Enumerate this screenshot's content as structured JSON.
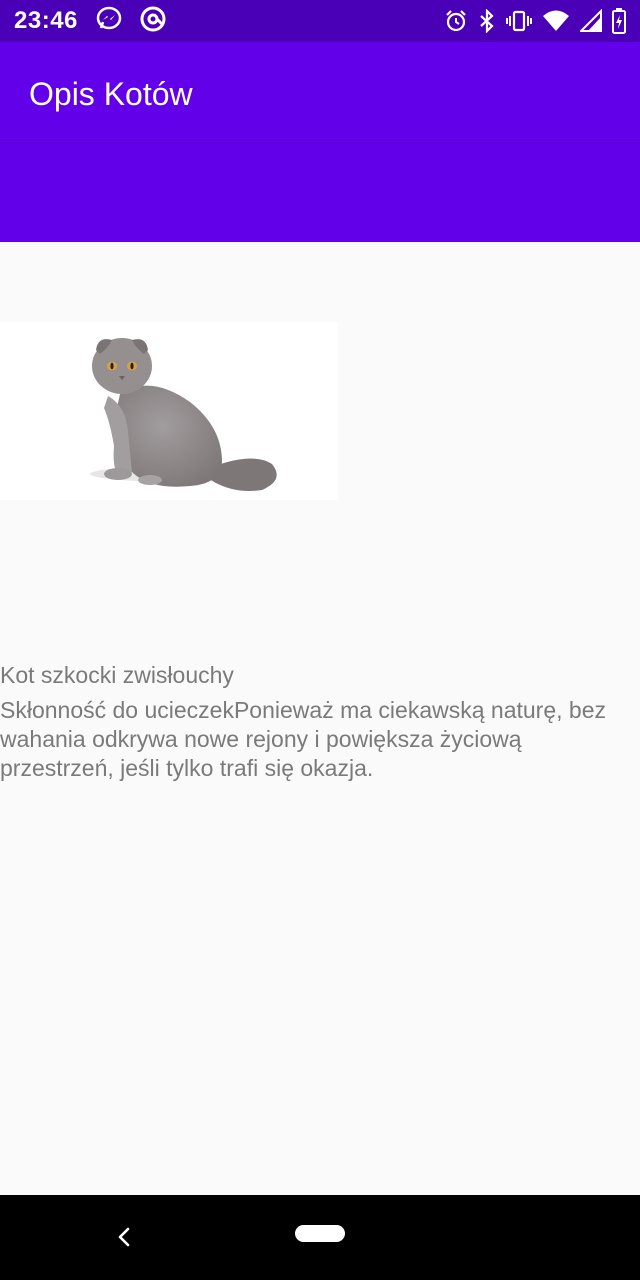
{
  "status_bar": {
    "time": "23:46",
    "left_icons": [
      "messenger-icon",
      "at-sign-icon"
    ],
    "right_icons": [
      "alarm-icon",
      "bluetooth-icon",
      "vibrate-icon",
      "wifi-icon",
      "signal-icon",
      "battery-icon"
    ]
  },
  "app_bar": {
    "title": "Opis Kotów",
    "color": "#6200ea"
  },
  "content": {
    "image": "cat-photo",
    "cat_name": "Kot szkocki zwisłouchy",
    "description": "Skłonność do ucieczekPonieważ ma ciekawską naturę, bez wahania odkrywa nowe rejony i powiększa życiową przestrzeń, jeśli tylko trafi się okazja."
  },
  "nav_bar": {
    "icons": [
      "back-icon",
      "home-pill-icon"
    ]
  }
}
